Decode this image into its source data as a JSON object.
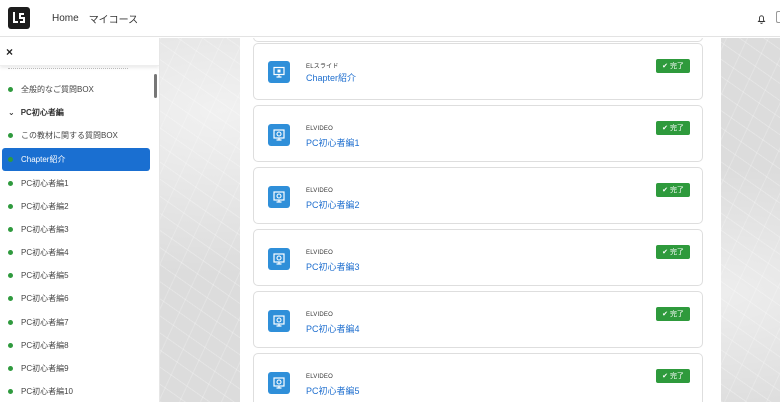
{
  "topbar": {
    "nav": [
      "Home",
      "マイコース"
    ]
  },
  "sidebar": {
    "close_label": "×",
    "items": [
      {
        "label": "全般的なご質問BOX",
        "type": "item"
      },
      {
        "label": "PC初心者編",
        "type": "group"
      },
      {
        "label": "この教材に関する質問BOX",
        "type": "item"
      },
      {
        "label": "Chapter紹介",
        "type": "active"
      },
      {
        "label": "PC初心者編1",
        "type": "item"
      },
      {
        "label": "PC初心者編2",
        "type": "item"
      },
      {
        "label": "PC初心者編3",
        "type": "item"
      },
      {
        "label": "PC初心者編4",
        "type": "item"
      },
      {
        "label": "PC初心者編5",
        "type": "item"
      },
      {
        "label": "PC初心者編6",
        "type": "item"
      },
      {
        "label": "PC初心者編7",
        "type": "item"
      },
      {
        "label": "PC初心者編8",
        "type": "item"
      },
      {
        "label": "PC初心者編9",
        "type": "item"
      },
      {
        "label": "PC初心者編10",
        "type": "item"
      }
    ]
  },
  "cards": [
    {
      "type": "ELスライド",
      "title": "Chapter紹介",
      "badge": "完了",
      "icon": "slide-icon"
    },
    {
      "type": "ELVIDEO",
      "title": "PC初心者編1",
      "badge": "完了",
      "icon": "video-icon"
    },
    {
      "type": "ELVIDEO",
      "title": "PC初心者編2",
      "badge": "完了",
      "icon": "video-icon"
    },
    {
      "type": "ELVIDEO",
      "title": "PC初心者編3",
      "badge": "完了",
      "icon": "video-icon"
    },
    {
      "type": "ELVIDEO",
      "title": "PC初心者編4",
      "badge": "完了",
      "icon": "video-icon"
    },
    {
      "type": "ELVIDEO",
      "title": "PC初心者編5",
      "badge": "完了",
      "icon": "video-icon"
    }
  ],
  "colors": {
    "accent": "#1a6fd1",
    "link": "#1f6fcf",
    "success": "#2e9a3c",
    "icon_bg": "#2f8fd9"
  }
}
